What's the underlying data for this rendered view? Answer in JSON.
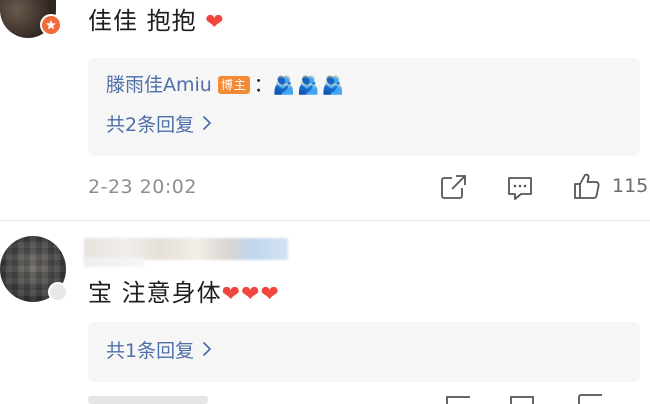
{
  "comments": [
    {
      "text": "佳佳 抱抱",
      "text_heart": "❤",
      "reply_preview": {
        "author": "滕雨佳Amiu",
        "author_badge": "博主",
        "separator": "：",
        "content_emoji": "🫂🫂🫂"
      },
      "reply_count_label": "共2条回复",
      "timestamp": "2-23 20:02",
      "like_count": "115"
    },
    {
      "text": "宝 注意身体",
      "text_hearts": "❤❤❤",
      "reply_count_label": "共1条回复"
    }
  ],
  "icons": {
    "share": "share-icon",
    "comment": "comment-icon",
    "like": "like-icon",
    "chevron": "chevron-right-icon"
  },
  "colors": {
    "link_blue": "#4f6fa8",
    "blogger_badge": "#f28b34",
    "heart_red": "#f2453d",
    "reply_bg": "#f6f6f6"
  }
}
